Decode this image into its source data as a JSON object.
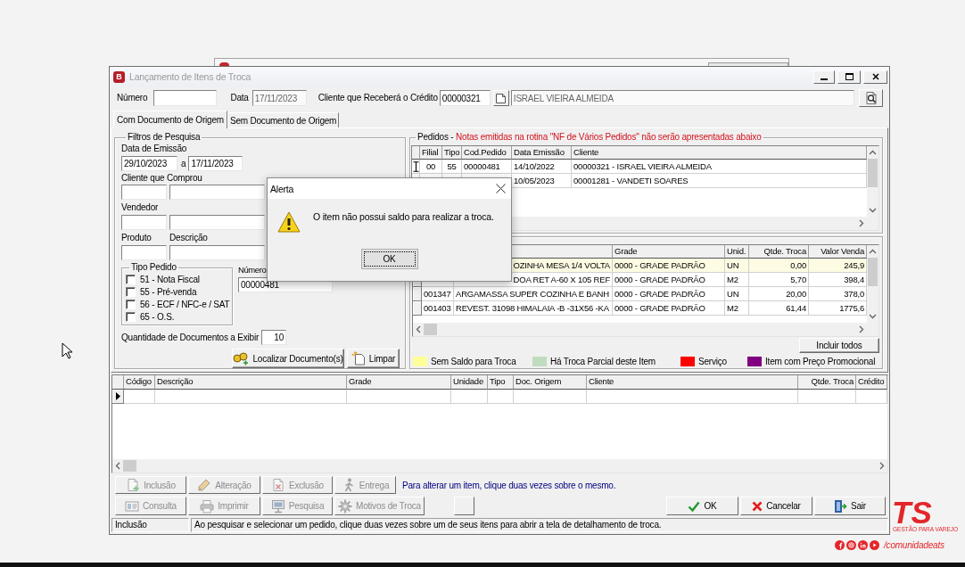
{
  "window": {
    "app_icon_letter": "B",
    "title": "Lançamento de Itens de Troca",
    "active": false
  },
  "header": {
    "number_label": "Número",
    "date_label": "Data",
    "date": {
      "value": "17/11/2023",
      "disabled": true
    },
    "credit_client_label": "Cliente que Receberá o Crédito",
    "credit_client_code": "00000321",
    "credit_client_name": {
      "value": "ISRAEL VIEIRA ALMEIDA",
      "disabled": true
    }
  },
  "tabs": [
    {
      "label": "Com Documento de Origem",
      "selected": true
    },
    {
      "label": "Sem Documento de Origem",
      "selected": false
    }
  ],
  "filters": {
    "title": "Filtros de Pesquisa",
    "emission_date_label": "Data de Emissão",
    "emission_date_from": "29/10/2023",
    "range_separator": "a",
    "emission_date_to": "17/11/2023",
    "buyer_label": "Cliente que Comprou",
    "seller_label": "Vendedor",
    "product_label": "Produto",
    "description_label": "Descrição",
    "order_type": {
      "title": "Tipo Pedido",
      "options": [
        {
          "label": "51 - Nota Fiscal",
          "checked": false
        },
        {
          "label": "55 - Pré-venda",
          "checked": false
        },
        {
          "label": "56 - ECF / NFC-e / SAT",
          "checked": false
        },
        {
          "label": "65 - O.S.",
          "checked": false
        }
      ]
    },
    "order_number_label": "Número",
    "order_number": "00000481",
    "quantity_label": "Quantidade de Documentos a Exibir",
    "quantity": "10",
    "find_button": "Localizar Documento(s)",
    "clear_button": "Limpar"
  },
  "orders": {
    "title": "Pedidos -",
    "note": "Notas emitidas na rotina \"NF de Vários Pedidos\" não serão apresentadas abaixo",
    "columns": [
      "Filial",
      "Tipo",
      "Cod.Pedido",
      "Data Emissão",
      "Cliente"
    ],
    "rows": [
      {
        "selected": true,
        "branch": "00",
        "type": "55",
        "order": "00000481",
        "date": "14/10/2022",
        "client": "00000321 - ISRAEL VIEIRA ALMEIDA"
      },
      {
        "selected": false,
        "date": "10/05/2023",
        "client": "00001281 - VANDETI SOARES"
      }
    ]
  },
  "items": {
    "columns": [
      "Grade",
      "Unid.",
      "Qtde. Troca",
      "Valor Venda"
    ],
    "rows": [
      {
        "no_balance": true,
        "description": "OZINHA MESA 1/4 VOLTA",
        "grade": "0000 - GRADE PADRÃO",
        "unit": "UN",
        "qty": "0,00",
        "value": "245,9"
      },
      {
        "no_balance": false,
        "description": "DOA RET A-60 X 105 REF",
        "grade": "0000 - GRADE PADRÃO",
        "unit": "M2",
        "qty": "5,70",
        "value": "398,4"
      },
      {
        "no_balance": false,
        "code": "001347",
        "description": "ARGAMASSA SUPER COZINHA E BANH",
        "grade": "0000 - GRADE PADRÃO",
        "unit": "UN",
        "qty": "20,00",
        "value": "378,0"
      },
      {
        "no_balance": false,
        "code": "001403",
        "description": "REVEST. 31098 HIMALAIA -B -31X56 -KA",
        "grade": "0000 - GRADE PADRÃO",
        "unit": "M2",
        "qty": "61,44",
        "value": "1775,6"
      }
    ],
    "include_all_button": "Incluir todos",
    "legend": [
      {
        "label": "Sem Saldo para Troca",
        "color": "#ffff99"
      },
      {
        "label": "Há Troca Parcial deste Item",
        "color": "#c0dcc0"
      },
      {
        "label": "Serviço",
        "color": "#ff0000"
      },
      {
        "label": "Item com Preço Promocional",
        "color": "#800080"
      }
    ]
  },
  "exchange_items": {
    "columns": [
      "Código",
      "Descrição",
      "Grade",
      "Unidade",
      "Tipo",
      "Doc. Origem",
      "Cliente",
      "Qtde. Troca",
      "Crédito"
    ],
    "rows": [
      {
        "selected": true
      }
    ]
  },
  "actions": {
    "row_1": [
      {
        "label": "Inclusão",
        "disabled": true
      },
      {
        "label": "Alteração",
        "disabled": true
      },
      {
        "label": "Exclusão",
        "disabled": true
      },
      {
        "label": "Entrega",
        "disabled": true
      }
    ],
    "hint": "Para alterar um item, clique duas vezes sobre o mesmo.",
    "row_2": [
      {
        "label": "Consulta",
        "disabled": true
      },
      {
        "label": "Imprimir",
        "disabled": true
      },
      {
        "label": "Pesquisa",
        "disabled": true
      },
      {
        "label": "Motivos de Troca",
        "disabled": true
      }
    ],
    "confirm": [
      {
        "label": "OK",
        "disabled": false
      },
      {
        "label": "Cancelar",
        "disabled": false
      },
      {
        "label": "Sair",
        "disabled": false
      }
    ]
  },
  "status_bar": [
    "Inclusão",
    "Ao pesquisar e selecionar um pedido, clique duas vezes sobre um de seus itens para abrir a tela de detalhamento de troca."
  ],
  "alert": {
    "title": "Alerta",
    "message": "O item não possui saldo para realizar a troca.",
    "button": "OK"
  },
  "branding": {
    "logo": "TS",
    "tagline": "GESTÃO PARA VAREJO",
    "handle": "/comunidadeats"
  }
}
